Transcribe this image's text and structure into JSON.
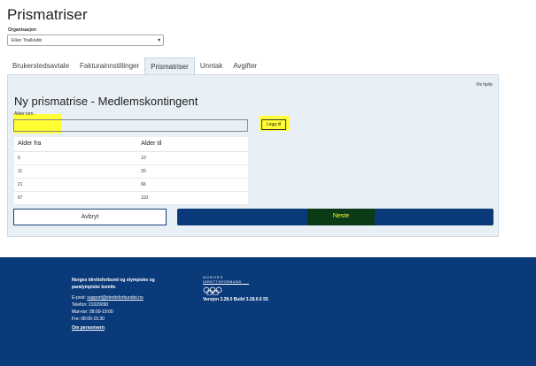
{
  "page": {
    "title": "Prismatriser"
  },
  "organization": {
    "label": "Organisasjon",
    "selected": "Eiker Trialklubb"
  },
  "tabs": [
    "Brukerstedsavtale",
    "Fakturainnstillinger",
    "Prismatriser",
    "Unntak",
    "Avgifter"
  ],
  "active_tab": "Prismatriser",
  "panel": {
    "help_link": "Vis hjelp",
    "title": "Ny prismatrise - Medlemskontingent",
    "age_label": "Alder tom.",
    "age_value": "",
    "add_button": "Legg til",
    "table": {
      "headers": [
        "Alder fra",
        "Alder til"
      ],
      "rows": [
        [
          "6",
          "10"
        ],
        [
          "11",
          "20"
        ],
        [
          "21",
          "66"
        ],
        [
          "67",
          "110"
        ]
      ]
    },
    "cancel_button": "Avbryt",
    "next_button": "Neste"
  },
  "footer": {
    "org_name": "Norges idrettsforbund og olympiske og paralympiske komite",
    "email_prefix": "E-post: ",
    "email": "support@idrettsforbundet.no",
    "phone": "Telefon: 21029090",
    "hours_weekday": "Man-tor: 08:00-19:00",
    "hours_friday": "Fre: 08:00-15:30",
    "privacy_link": "Om personvern",
    "logo_line1": "NORGES",
    "logo_line2": "IDRETTSFORBUND",
    "version": "Versjon 3.28.0 Build 3.28.0.6 55"
  },
  "colors": {
    "accent": "#0b3a7a",
    "highlight": "#ffff33",
    "panel_bg": "#e8f0f6"
  }
}
